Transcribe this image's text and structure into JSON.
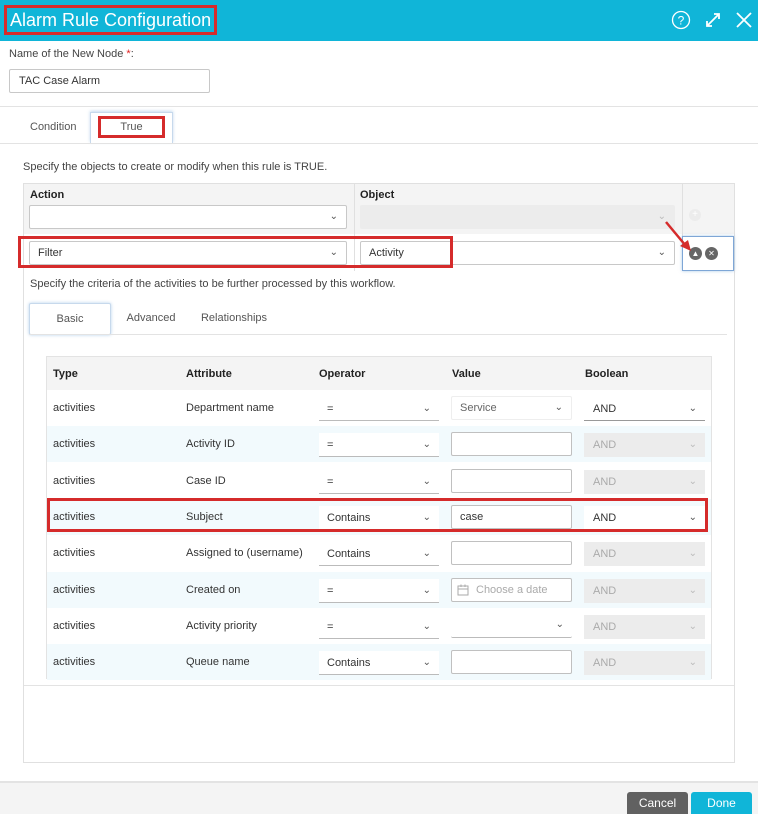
{
  "window": {
    "title": "Alarm Rule Configuration",
    "icons": [
      "help-icon",
      "expand-icon",
      "close-icon"
    ]
  },
  "node_name": {
    "label": "Name of the New Node",
    "required_mark": "*",
    "label_suffix": ":",
    "value": "TAC Case Alarm"
  },
  "tabs": [
    {
      "label": "Condition",
      "active": false
    },
    {
      "label": "True",
      "active": true
    }
  ],
  "true_section": {
    "description": "Specify the objects to create or modify when this rule is TRUE.",
    "headers": {
      "action": "Action",
      "object": "Object"
    },
    "rows": [
      {
        "action": "",
        "object": "",
        "object_disabled": true
      },
      {
        "action": "Filter",
        "object": "Activity",
        "object_disabled": false
      }
    ]
  },
  "filter": {
    "description": "Specify the criteria of the activities to be further processed by this workflow.",
    "subtabs": [
      {
        "label": "Basic",
        "active": true
      },
      {
        "label": "Advanced",
        "active": false
      },
      {
        "label": "Relationships",
        "active": false
      }
    ],
    "columns": [
      "Type",
      "Attribute",
      "Operator",
      "Value",
      "Boolean"
    ],
    "rows": [
      {
        "type": "activities",
        "attribute": "Department name",
        "operator": "=",
        "value": "Service",
        "value_kind": "select",
        "boolean": "AND",
        "boolean_enabled": true
      },
      {
        "type": "activities",
        "attribute": "Activity ID",
        "operator": "=",
        "value": "",
        "value_kind": "text",
        "boolean": "AND",
        "boolean_enabled": false
      },
      {
        "type": "activities",
        "attribute": "Case ID",
        "operator": "=",
        "value": "",
        "value_kind": "text",
        "boolean": "AND",
        "boolean_enabled": false
      },
      {
        "type": "activities",
        "attribute": "Subject",
        "operator": "Contains",
        "value": "case",
        "value_kind": "text",
        "boolean": "AND",
        "boolean_enabled": true
      },
      {
        "type": "activities",
        "attribute": "Assigned to (username)",
        "operator": "Contains",
        "value": "",
        "value_kind": "text",
        "boolean": "AND",
        "boolean_enabled": false
      },
      {
        "type": "activities",
        "attribute": "Created on",
        "operator": "=",
        "value": "",
        "value_placeholder": "Choose a date",
        "value_kind": "date",
        "boolean": "AND",
        "boolean_enabled": false
      },
      {
        "type": "activities",
        "attribute": "Activity priority",
        "operator": "=",
        "value": "",
        "value_kind": "dropdown",
        "boolean": "AND",
        "boolean_enabled": false
      },
      {
        "type": "activities",
        "attribute": "Queue name",
        "operator": "Contains",
        "value": "",
        "value_kind": "text",
        "boolean": "AND",
        "boolean_enabled": false
      }
    ]
  },
  "footer": {
    "cancel": "Cancel",
    "done": "Done"
  },
  "colors": {
    "titlebar": "#10b5d8",
    "highlight": "#d52b2b",
    "cancel_button": "#616161",
    "done_button": "#10b5d8"
  }
}
